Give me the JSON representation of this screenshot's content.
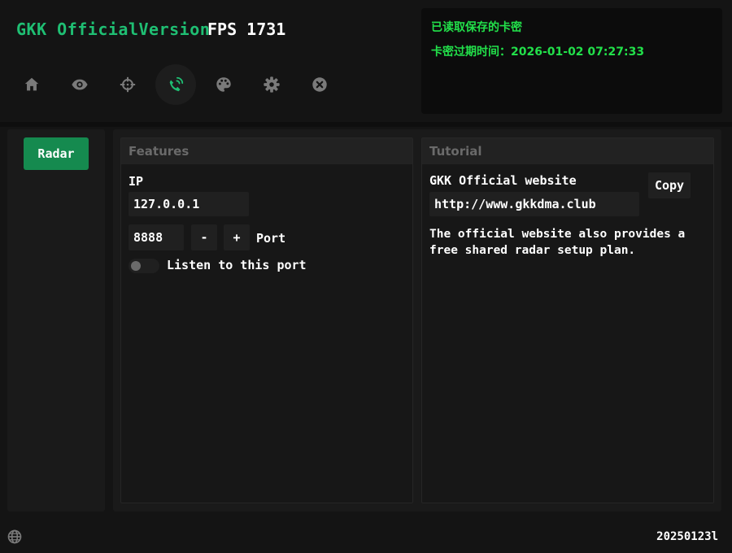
{
  "header": {
    "app_title": "GKK OfficialVersion",
    "fps": "FPS 1731"
  },
  "nav": {
    "active": "radar",
    "items": [
      {
        "name": "home-icon"
      },
      {
        "name": "eye-icon"
      },
      {
        "name": "crosshair-icon"
      },
      {
        "name": "radar-icon"
      },
      {
        "name": "palette-icon"
      },
      {
        "name": "gear-icon"
      },
      {
        "name": "close-icon"
      }
    ]
  },
  "status": {
    "line1": "已读取保存的卡密",
    "line2": "卡密过期时间：2026-01-02 07:27:33"
  },
  "sidebar": {
    "radar_label": "Radar"
  },
  "features": {
    "header": "Features",
    "ip_label": "IP",
    "ip_value": "127.0.0.1",
    "port_value": "8888",
    "minus_label": "-",
    "plus_label": "+",
    "port_label": "Port",
    "listen_label": "Listen to this port",
    "listen_enabled": false
  },
  "tutorial": {
    "header": "Tutorial",
    "website_label": "GKK Official website",
    "url": "http://www.gkkdma.club",
    "copy_label": "Copy",
    "description": "The official website also provides a free shared radar setup plan."
  },
  "footer": {
    "build": "20250123l"
  },
  "colors": {
    "accent_green": "#1fbf73",
    "status_green": "#22e04a",
    "button_green": "#158a4f"
  }
}
